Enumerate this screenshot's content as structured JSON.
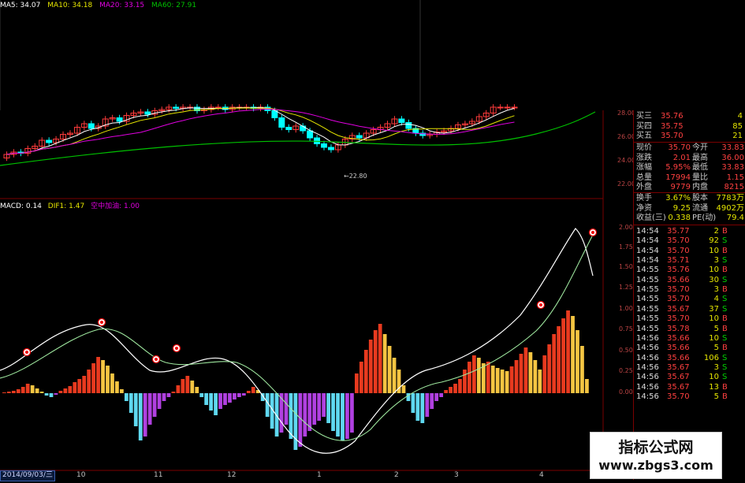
{
  "ma_header": {
    "ma5": "MA5: 34.07",
    "ma10": "MA10: 34.18",
    "ma20": "MA20: 33.15",
    "ma60": "MA60: 27.91"
  },
  "macd_header": {
    "macd": "MACD: 0.14",
    "dif": "DIF1: 1.47",
    "signal": "空中加油: 1.00"
  },
  "price_axis": [
    "28.00",
    "26.00",
    "24.00",
    "22.00"
  ],
  "macd_axis": [
    "2.00",
    "1.75",
    "1.50",
    "1.25",
    "1.00",
    "0.75",
    "0.50",
    "0.25",
    "0.00"
  ],
  "low_marker": "22.80",
  "x_labels": [
    "10",
    "11",
    "12",
    "1",
    "2",
    "3",
    "4"
  ],
  "date_box": "2014/09/03/三",
  "quote": [
    {
      "label": "买三",
      "price": "35.76",
      "vol": "4"
    },
    {
      "label": "买四",
      "price": "35.75",
      "vol": "85"
    },
    {
      "label": "买五",
      "price": "35.70",
      "vol": "21"
    }
  ],
  "stats": [
    {
      "l1": "现价",
      "v1": "35.70",
      "l2": "今开",
      "v2": "33.83"
    },
    {
      "l1": "涨跌",
      "v1": "2.01",
      "l2": "最高",
      "v2": "36.00"
    },
    {
      "l1": "涨幅",
      "v1": "5.95%",
      "l2": "最低",
      "v2": "33.83"
    },
    {
      "l1": "总量",
      "v1": "17994",
      "l2": "量比",
      "v2": "1.15"
    },
    {
      "l1": "外盘",
      "v1": "9779",
      "l2": "内盘",
      "v2": "8215"
    }
  ],
  "stats2": [
    {
      "l1": "换手",
      "v1": "3.67%",
      "l2": "股本",
      "v2": "7783万"
    },
    {
      "l1": "净资",
      "v1": "9.25",
      "l2": "流通",
      "v2": "4902万"
    },
    {
      "l1": "收益(三)",
      "v1": "0.338",
      "l2": "PE(动)",
      "v2": "79.4"
    }
  ],
  "ticks": [
    {
      "t": "14:54",
      "p": "35.77",
      "v": "2",
      "s": "B"
    },
    {
      "t": "14:54",
      "p": "35.70",
      "v": "92",
      "s": "S"
    },
    {
      "t": "14:54",
      "p": "35.70",
      "v": "10",
      "s": "B"
    },
    {
      "t": "14:54",
      "p": "35.71",
      "v": "3",
      "s": "S"
    },
    {
      "t": "14:55",
      "p": "35.76",
      "v": "10",
      "s": "B"
    },
    {
      "t": "14:55",
      "p": "35.66",
      "v": "30",
      "s": "S"
    },
    {
      "t": "14:55",
      "p": "35.70",
      "v": "3",
      "s": "B"
    },
    {
      "t": "14:55",
      "p": "35.70",
      "v": "4",
      "s": "S"
    },
    {
      "t": "14:55",
      "p": "35.67",
      "v": "37",
      "s": "S"
    },
    {
      "t": "14:55",
      "p": "35.70",
      "v": "10",
      "s": "B"
    },
    {
      "t": "14:55",
      "p": "35.78",
      "v": "5",
      "s": "B"
    },
    {
      "t": "14:56",
      "p": "35.66",
      "v": "10",
      "s": "S"
    },
    {
      "t": "14:56",
      "p": "35.66",
      "v": "5",
      "s": "B"
    },
    {
      "t": "14:56",
      "p": "35.66",
      "v": "106",
      "s": "S"
    },
    {
      "t": "14:56",
      "p": "35.67",
      "v": "3",
      "s": "S"
    },
    {
      "t": "14:56",
      "p": "35.67",
      "v": "10",
      "s": "S"
    },
    {
      "t": "14:56",
      "p": "35.67",
      "v": "13",
      "s": "B"
    },
    {
      "t": "14:56",
      "p": "35.70",
      "v": "5",
      "s": "B"
    }
  ],
  "watermark": {
    "title": "指标公式网",
    "url": "www.zbgs3.com"
  },
  "colors": {
    "up": "#ff3b3b",
    "down": "#00ffff",
    "ma5": "#ffffff",
    "ma10": "#e6e600",
    "ma20": "#e000e0",
    "ma60": "#00c000",
    "grid": "#7a0000",
    "bar_red": "#e83a1f",
    "bar_yellow": "#f5c542",
    "bar_cyan": "#5fd8f0",
    "bar_purple": "#b040e0"
  }
}
